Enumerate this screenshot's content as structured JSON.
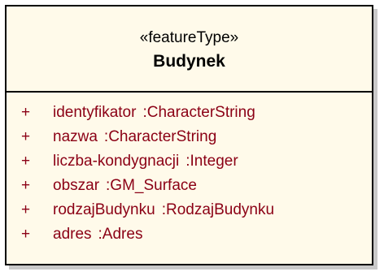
{
  "class": {
    "stereotype": "«featureType»",
    "name": "Budynek",
    "attributes": [
      {
        "visibility": "+",
        "name": "identyfikator",
        "type": ":CharacterString"
      },
      {
        "visibility": "+",
        "name": "nazwa",
        "type": ":CharacterString"
      },
      {
        "visibility": "+",
        "name": "liczba-kondygnacji",
        "type": ":Integer"
      },
      {
        "visibility": "+",
        "name": "obszar",
        "type": ":GM_Surface"
      },
      {
        "visibility": "+",
        "name": "rodzajBudynku",
        "type": ":RodzajBudynku"
      },
      {
        "visibility": "+",
        "name": "adres",
        "type": ":Adres"
      }
    ]
  },
  "colors": {
    "class_fill": "#fffaea",
    "border": "#000000",
    "attribute_text": "#8b0015",
    "shadow": "#c9c9c9"
  }
}
